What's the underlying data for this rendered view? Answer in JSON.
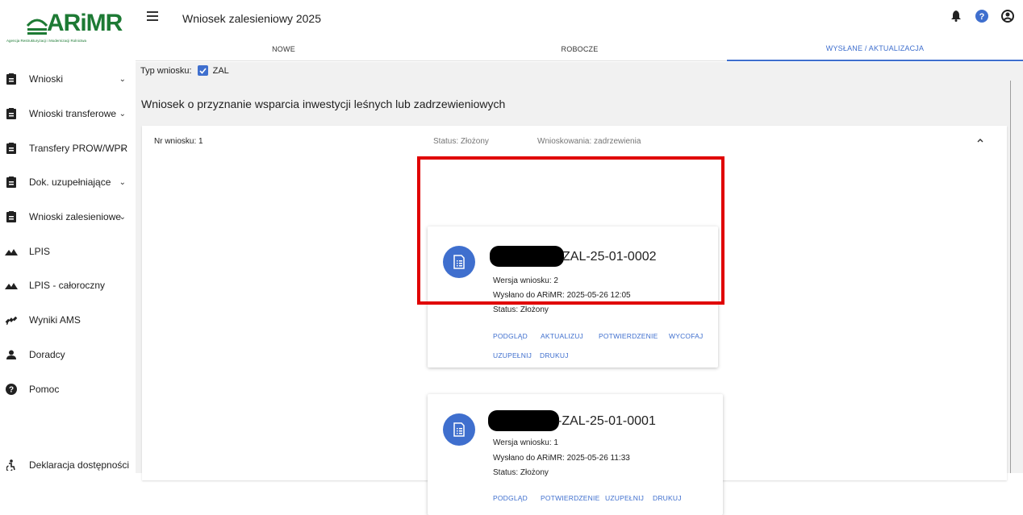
{
  "logo": {
    "text": "ARiMR",
    "subtitle": "Agencja Restrukturyzacji i Modernizacji Rolnictwa"
  },
  "sidebar": {
    "items": [
      {
        "label": "Wnioski",
        "icon": "clipboard-icon",
        "chevron": "⌄"
      },
      {
        "label": "Wnioski transferowe",
        "icon": "clipboard-icon",
        "chevron": "⌄"
      },
      {
        "label": "Transfery PROW/WPR",
        "icon": "clipboard-icon",
        "chevron": "⌄"
      },
      {
        "label": "Dok. uzupełniające",
        "icon": "clipboard-icon",
        "chevron": "⌄"
      },
      {
        "label": "Wnioski zalesieniowe",
        "icon": "clipboard-icon",
        "chevron": "⌄"
      },
      {
        "label": "LPIS",
        "icon": "terrain-icon"
      },
      {
        "label": "LPIS - całoroczny",
        "icon": "terrain-icon"
      },
      {
        "label": "Wyniki AMS",
        "icon": "satellite-icon"
      },
      {
        "label": "Doradcy",
        "icon": "person-icon"
      },
      {
        "label": "Pomoc",
        "icon": "help-icon"
      }
    ],
    "footer": {
      "label": "Deklaracja dostępności",
      "icon": "accessibility-icon"
    }
  },
  "header": {
    "title": "Wniosek zalesieniowy 2025",
    "icons": [
      "bell-icon",
      "help-circle-icon",
      "account-icon"
    ]
  },
  "tabs": [
    {
      "label": "NOWE",
      "active": false
    },
    {
      "label": "ROBOCZE",
      "active": false
    },
    {
      "label": "WYSŁANE / AKTUALIZACJA",
      "active": true
    }
  ],
  "filter": {
    "label": "Typ wniosku:",
    "checkbox_label": "ZAL",
    "checked": true
  },
  "main": {
    "heading": "Wniosek o przyznanie wsparcia inwestycji leśnych lub zadrzewieniowych",
    "panel": {
      "nr": "Nr wniosku: 1",
      "status": "Status: Złożony",
      "kind": "Wnioskowania: zadrzewienia"
    }
  },
  "cards": [
    {
      "id_suffix": "ZAL-25-01-0002",
      "version": "Wersja wniosku: 2",
      "sent": "Wysłano do ARiMR: 2025-05-26 12:05",
      "status": "Status: Złożony",
      "actions": [
        "PODGLĄD",
        "AKTUALIZUJ",
        "POTWIERDZENIE",
        "WYCOFAJ",
        "UZUPEŁNIJ",
        "DRUKUJ"
      ],
      "highlighted": true
    },
    {
      "id_suffix": "-ZAL-25-01-0001",
      "version": "Wersja wniosku: 1",
      "sent": "Wysłano do ARiMR: 2025-05-26 11:33",
      "status": "Status: Złożony",
      "actions": [
        "PODGLĄD",
        "POTWIERDZENIE",
        "UZUPEŁNIJ",
        "DRUKUJ"
      ],
      "highlighted": false
    }
  ],
  "colors": {
    "accent": "#3f6fce",
    "brand": "#1d7a34",
    "highlight": "#e00000",
    "background": "#f1f1f1"
  }
}
